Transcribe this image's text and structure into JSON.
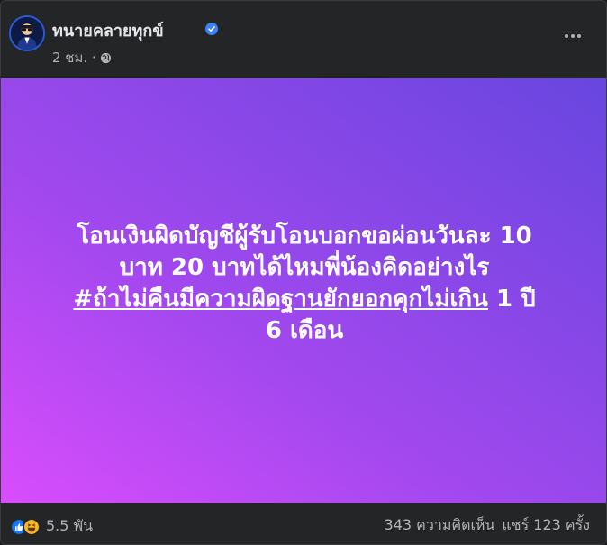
{
  "post": {
    "author": "ทนายคลายทุกข์",
    "time": "2 ชม. ·",
    "text_lines": [
      "โอนเงินผิดบัญชีผู้รับโอนบอกขอผ่อนวันละ 10",
      "บาท 20 บาทได้ไหมพี่น้องคิดอย่างไร"
    ],
    "hashtag": "#ถ้าไม่คืนมีความผิดฐานยักยอกคุกไม่เกิน",
    "text_after_hashtag": " 1 ปี",
    "text_last_line": "6 เดือน",
    "reactions_count": "5.5 พัน",
    "comments": "343 ความคิดเห็น",
    "shares": "แชร์ 123 ครั้ง"
  },
  "colors": {
    "card_bg": "#242526",
    "text_primary": "#e4e6eb",
    "text_secondary": "#b0b3b8",
    "gradient_start": "#d84dfc",
    "gradient_end": "#6846df",
    "verified_blue": "#3b82f6"
  },
  "icons": {
    "verified": "verified-badge-icon",
    "privacy": "globe-icon",
    "more": "ellipsis-icon",
    "reaction_like": "like-icon",
    "reaction_haha": "haha-icon"
  }
}
